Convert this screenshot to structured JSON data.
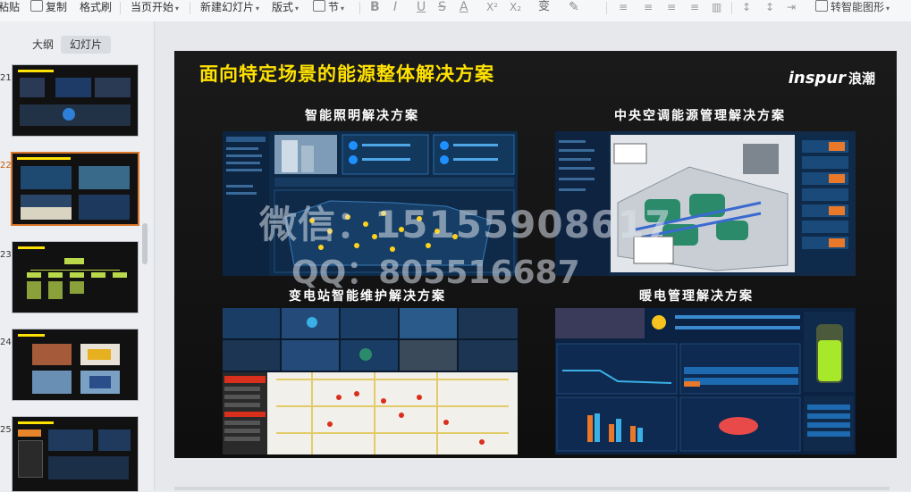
{
  "toolbar": {
    "paste": "粘贴",
    "copy": "复制",
    "format_painter": "格式刷",
    "from_current": "当页开始",
    "new_slide": "新建幻灯片",
    "layout": "版式",
    "section": "节",
    "bold": "B",
    "italic": "I",
    "underline": "U",
    "strike": "S",
    "font_color": "A",
    "superscript": "X²",
    "subscript": "X₂",
    "change_case": "变",
    "smart_art": "转智能图形"
  },
  "sidebar": {
    "tabs": [
      "大纲",
      "幻灯片"
    ],
    "active_tab": 1,
    "slide_numbers": [
      "21",
      "22",
      "23",
      "24",
      "25"
    ],
    "selected_index": 1
  },
  "slide": {
    "title": "面向特定场景的能源整体解决方案",
    "logo_latin": "inspur",
    "logo_cn": "浪潮",
    "sections": [
      {
        "title": "智能照明解决方案"
      },
      {
        "title": "中央空调能源管理解决方案"
      },
      {
        "title": "变电站智能维护解决方案"
      },
      {
        "title": "暖电管理解决方案"
      }
    ]
  },
  "watermark": {
    "line1": "微信：15155908617",
    "line2": "QQ：805516687"
  },
  "colors": {
    "title_yellow": "#ffe200",
    "selected_border": "#d9782d",
    "slide_bg": "#141414"
  }
}
